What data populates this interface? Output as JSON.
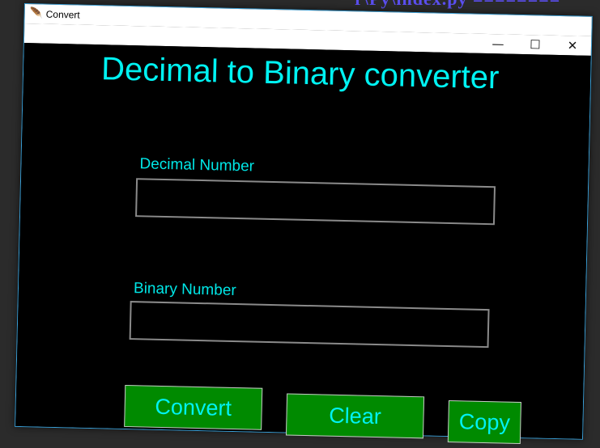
{
  "background": {
    "code_text": "r\\Py\\index.py ========"
  },
  "window": {
    "title": "Convert",
    "caption_buttons": [
      {
        "label": "—",
        "icon": "minimize-icon"
      },
      {
        "label": "☐",
        "icon": "maximize-icon"
      },
      {
        "label": "✕",
        "icon": "close-icon"
      }
    ]
  },
  "app": {
    "heading": "Decimal to Binary converter",
    "decimal_label": "Decimal Number",
    "decimal_value": "",
    "binary_label": "Binary Number",
    "binary_value": "",
    "buttons": {
      "convert": "Convert",
      "clear": "Clear",
      "copy": "Copy"
    }
  },
  "colors": {
    "background": "#000000",
    "text": "#00f2f2",
    "button": "#008a00",
    "border": "#3aa0d8"
  }
}
